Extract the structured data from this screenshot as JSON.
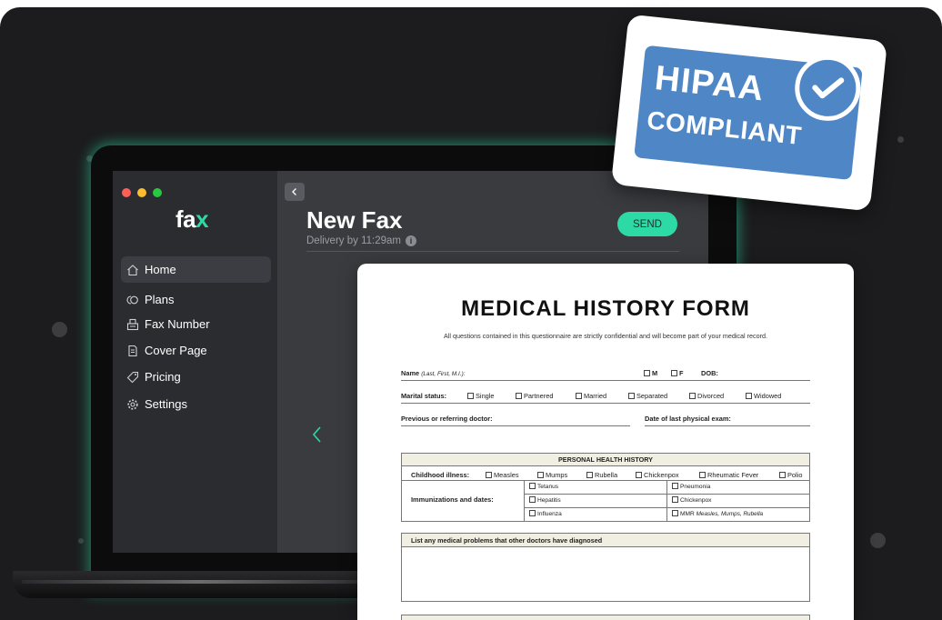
{
  "colors": {
    "accent": "#2ddaa6",
    "badge_blue": "#4e86c6",
    "backdrop": "#1c1c1e",
    "sidebar": "#2b2c30",
    "content": "#3a3b3f"
  },
  "app": {
    "logo_main": "fa",
    "logo_accent": "x",
    "sidebar": {
      "items": [
        {
          "label": "Home",
          "icon": "home-icon"
        },
        {
          "label": "Plans",
          "icon": "plans-icon"
        },
        {
          "label": "Fax Number",
          "icon": "fax-icon"
        },
        {
          "label": "Cover Page",
          "icon": "document-icon"
        },
        {
          "label": "Pricing",
          "icon": "tag-icon"
        },
        {
          "label": "Settings",
          "icon": "gear-icon"
        }
      ]
    },
    "header": {
      "title": "New Fax",
      "subtitle": "Delivery by 11:29am",
      "send_label": "SEND",
      "info_glyph": "i"
    }
  },
  "document": {
    "title": "MEDICAL HISTORY FORM",
    "intro": "All questions contained in this questionnaire are strictly confidential and will become part of your medical record.",
    "name_label": "Name",
    "name_hint": "(Last, First, M.I.):",
    "sex_m": "M",
    "sex_f": "F",
    "dob_label": "DOB:",
    "marital_label": "Marital status:",
    "marital_options": [
      "Single",
      "Partnered",
      "Married",
      "Separated",
      "Divorced",
      "Widowed"
    ],
    "doctor_label": "Previous or referring doctor:",
    "exam_label": "Date of last physical exam:",
    "section_title": "PERSONAL HEALTH HISTORY",
    "childhood_label": "Childhood illness:",
    "childhood_options": [
      "Measles",
      "Mumps",
      "Rubella",
      "Chickenpox",
      "Rheumatic Fever",
      "Polio"
    ],
    "immunizations_label": "Immunizations and dates:",
    "immunizations_left": [
      "Tetanus",
      "Hepatitis",
      "Influenza"
    ],
    "immunizations_right": [
      "Pneumonia",
      "Chickenpox",
      "MMR"
    ],
    "mmr_hint": "Measles, Mumps, Rubella",
    "problems_label": "List any medical problems that other doctors have diagnosed"
  },
  "badge": {
    "line1": "HIPAA",
    "line2": "COMPLIANT"
  }
}
